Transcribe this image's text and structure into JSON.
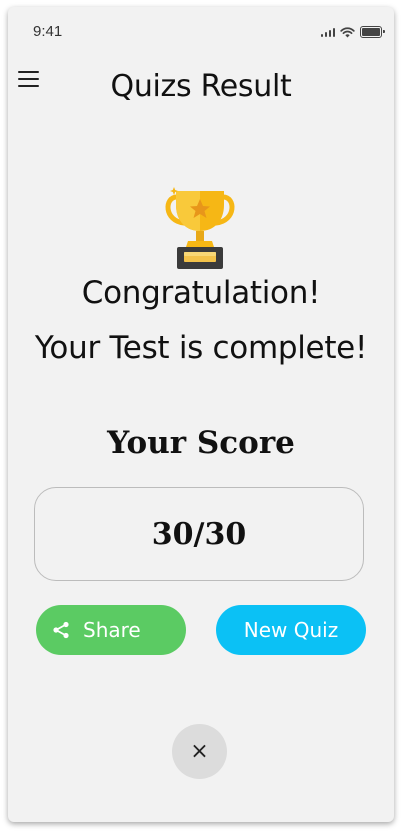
{
  "status_bar": {
    "time": "9:41",
    "icons": [
      "signal-icon",
      "wifi-icon",
      "battery-icon"
    ]
  },
  "header": {
    "menu_icon": "hamburger-menu-icon",
    "title": "Quizs Result"
  },
  "result": {
    "trophy_icon": "trophy-icon",
    "congrats": "Congratulation!",
    "complete": "Your Test is complete!",
    "score_label": "Your Score",
    "score_value": "30/30"
  },
  "actions": {
    "share_label": "Share",
    "share_icon": "share-icon",
    "new_quiz_label": "New Quiz",
    "close_glyph": "×",
    "close_icon": "close-icon"
  },
  "colors": {
    "background": "#f2f2f2",
    "share": "#5bcb63",
    "new_quiz": "#0bc1f5",
    "close_bg": "#dcdcdc",
    "trophy_gold": "#f6b715",
    "trophy_base": "#3b3b3b"
  }
}
